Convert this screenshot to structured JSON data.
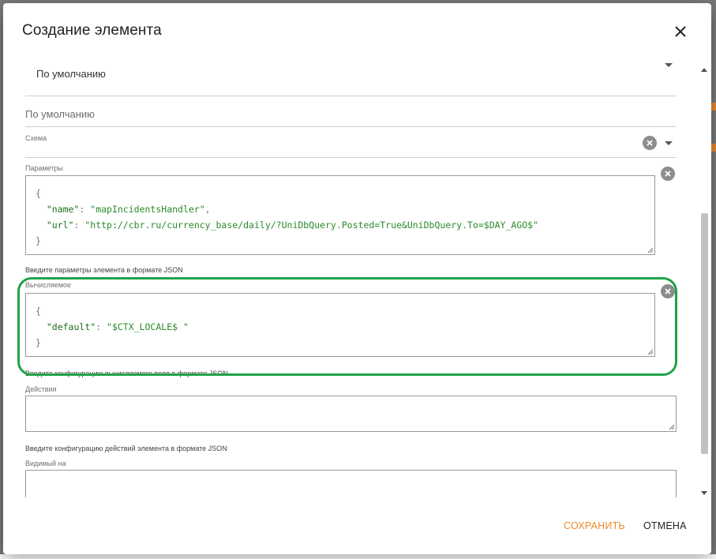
{
  "dialog": {
    "title": "Создание элемента",
    "close_icon": "close-icon"
  },
  "fields": {
    "top_select": {
      "value": "По умолчанию"
    },
    "default_input": {
      "placeholder": "По умолчанию"
    },
    "schema": {
      "label": "Схема"
    },
    "params": {
      "label": "Параметры",
      "code_lines": [
        [
          "{"
        ],
        [
          "  ",
          "\"name\"",
          ": ",
          "\"mapIncidentsHandler\"",
          ","
        ],
        [
          "  ",
          "\"url\"",
          ": ",
          "\"http://cbr.ru/currency_base/daily/?UniDbQuery.Posted=True&UniDbQuery.To=$DAY_AGO$\""
        ],
        [
          "}"
        ]
      ],
      "helper": "Введите параметры элемента в формате JSON"
    },
    "computed": {
      "label": "Вычисляемое",
      "code_lines": [
        [
          "{"
        ],
        [
          "  ",
          "\"default\"",
          ": ",
          "\"$CTX_LOCALE$ \""
        ],
        [
          "}"
        ]
      ],
      "helper": "Введите конфигурацию вычисляемого поля в формате JSON"
    },
    "actions": {
      "label": "Действия",
      "helper": "Введите конфигурацию действий элемента в формате JSON"
    },
    "visible_on": {
      "label": "Видимый на"
    }
  },
  "footer": {
    "save_label": "СОХРАНИТЬ",
    "cancel_label": "ОТМЕНА"
  },
  "colors": {
    "accent": "#f0882e",
    "highlight": "#1fa34a",
    "json_string": "#2a8a2a"
  }
}
